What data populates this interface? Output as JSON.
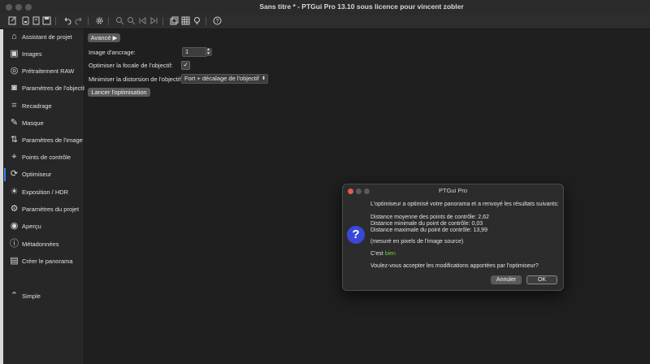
{
  "window": {
    "title": "Sans titre * - PTGui Pro 13.10 sous licence pour vincent zobler"
  },
  "sidebar": {
    "items": [
      {
        "label": "Assistant de projet",
        "icon": "project-assistant-icon"
      },
      {
        "label": "Images",
        "icon": "images-icon"
      },
      {
        "label": "Prétraitement RAW",
        "icon": "raw-preprocess-icon"
      },
      {
        "label": "Paramètres de l'objectif",
        "icon": "lens-icon"
      },
      {
        "label": "Recadrage",
        "icon": "crop-icon"
      },
      {
        "label": "Masque",
        "icon": "mask-icon"
      },
      {
        "label": "Paramètres de l'image",
        "icon": "image-params-icon"
      },
      {
        "label": "Points de contrôle",
        "icon": "control-points-icon"
      },
      {
        "label": "Optimiseur",
        "icon": "optimizer-icon"
      },
      {
        "label": "Exposition / HDR",
        "icon": "exposure-icon"
      },
      {
        "label": "Paramètres du projet",
        "icon": "project-settings-icon"
      },
      {
        "label": "Aperçu",
        "icon": "preview-icon"
      },
      {
        "label": "Métadonnées",
        "icon": "metadata-icon"
      },
      {
        "label": "Créer le panorama",
        "icon": "create-panorama-icon"
      },
      {
        "label": "Simple",
        "icon": "simple-mode-icon"
      }
    ],
    "active": "Optimiseur"
  },
  "main": {
    "advanced_button": "Avancé ▶",
    "anchor_label": "Image d'ancrage:",
    "anchor_value": "1",
    "optimize_focal_label": "Optimiser la focale de l'objectif:",
    "optimize_focal_checked": "✓",
    "minimize_distortion_label": "Minimiser la distorsion de l'objectif:",
    "minimize_distortion_value": "Fort + décalage de l'objectif",
    "run_button": "Lancer l'optimisation"
  },
  "dialog": {
    "title": "PTGui Pro",
    "intro": "L'optimiseur a optimisé votre panorama et a renvoyé les résultats suivants:",
    "avg": "Distance moyenne des points de contrôle: 2,62",
    "min": "Distance minimale du point de contrôle: 0,03",
    "max": "Distance maximale du point de contrôle: 13,99",
    "note": "(mesuré en pixels de l'image source)",
    "verdict_prefix": "C'est ",
    "verdict_word": "bien",
    "verdict_color": "#6ecb3f",
    "question": "Voulez-vous accepter les modifications apportées par l'optimiseur?",
    "cancel": "Annuler",
    "ok": "OK",
    "accent": "#3a48d9"
  }
}
